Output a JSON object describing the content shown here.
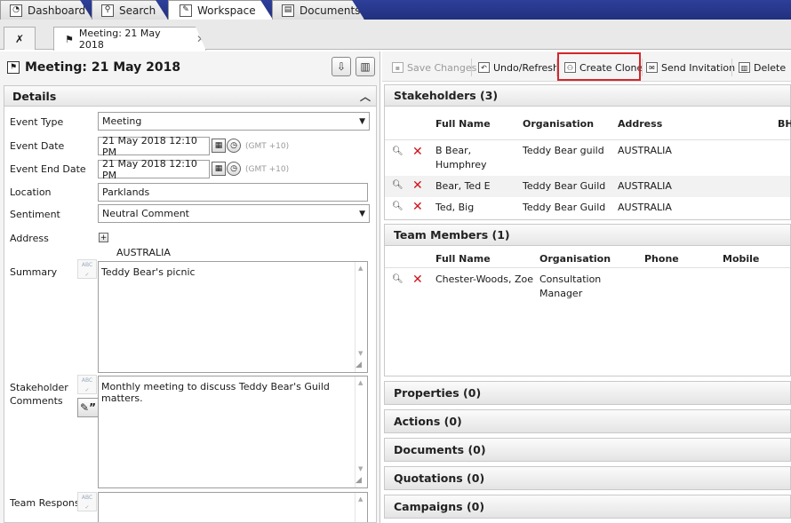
{
  "top_tabs": [
    {
      "label": "Dashboard",
      "icon": "dashboard-icon"
    },
    {
      "label": "Search",
      "icon": "search-icon"
    },
    {
      "label": "Workspace",
      "icon": "pencil-icon"
    },
    {
      "label": "Documents",
      "icon": "document-icon"
    }
  ],
  "doc_tab": {
    "label": "Meeting: 21 May 2018",
    "close": "✕"
  },
  "record": {
    "title": "Meeting: 21 May 2018"
  },
  "details": {
    "header": "Details",
    "fields": {
      "event_type": {
        "label": "Event Type",
        "value": "Meeting"
      },
      "event_date": {
        "label": "Event Date",
        "value": "21 May 2018 12:10 PM",
        "tz": "(GMT +10)"
      },
      "event_end_date": {
        "label": "Event End Date",
        "value": "21 May 2018 12:10 PM",
        "tz": "(GMT +10)"
      },
      "location": {
        "label": "Location",
        "value": "Parklands"
      },
      "sentiment": {
        "label": "Sentiment",
        "value": "Neutral Comment"
      },
      "address": {
        "label": "Address",
        "value": "AUSTRALIA"
      },
      "summary": {
        "label": "Summary",
        "value": "Teddy Bear's picnic"
      },
      "stakeholder_comments": {
        "label_line1": "Stakeholder",
        "label_line2": "Comments",
        "value": "Monthly meeting to discuss Teddy Bear's Guild matters."
      },
      "team_response": {
        "label": "Team Response",
        "value": ""
      }
    },
    "spell_label": "ABC"
  },
  "toolbar": {
    "save": "Save Changes",
    "undo": "Undo/Refresh",
    "clone": "Create Clone",
    "invite": "Send Invitation",
    "delete": "Delete"
  },
  "stakeholders": {
    "header": "Stakeholders (3)",
    "columns": [
      "Full Name",
      "Organisation",
      "Address",
      "BH"
    ],
    "rows": [
      {
        "name_line1": "B Bear,",
        "name_line2": "Humphrey",
        "org": "Teddy Bear guild",
        "address": "AUSTRALIA"
      },
      {
        "name_line1": "Bear, Ted E",
        "name_line2": "",
        "org": "Teddy Bear Guild",
        "address": "AUSTRALIA"
      },
      {
        "name_line1": "Ted, Big",
        "name_line2": "",
        "org": "Teddy Bear Guild",
        "address": "AUSTRALIA"
      }
    ]
  },
  "team_members": {
    "header": "Team Members (1)",
    "columns": [
      "Full Name",
      "Organisation",
      "Phone",
      "Mobile"
    ],
    "rows": [
      {
        "name": "Chester-Woods, Zoe",
        "org_line1": "Consultation",
        "org_line2": "Manager",
        "phone": "",
        "mobile": ""
      }
    ]
  },
  "collapsed_sections": [
    "Properties (0)",
    "Actions (0)",
    "Documents (0)",
    "Quotations (0)",
    "Campaigns (0)"
  ],
  "colors": {
    "topbar": "#22307d",
    "highlight": "#d3262c",
    "delete_x": "#d0121a"
  }
}
